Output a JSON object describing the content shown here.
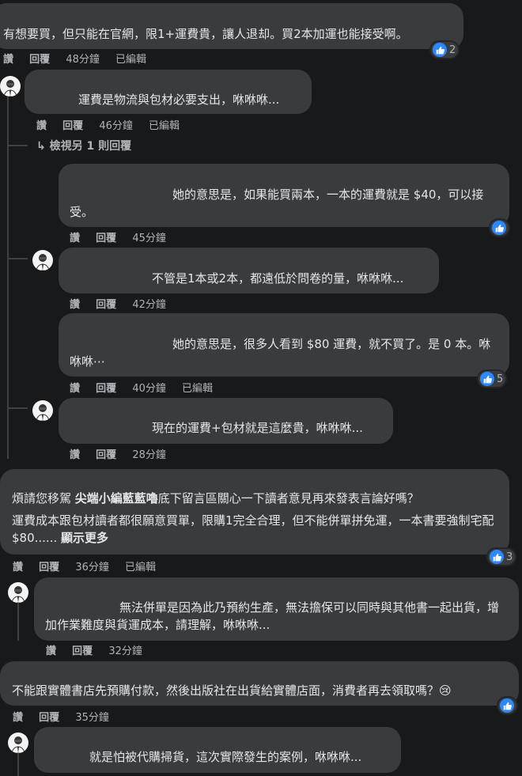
{
  "labels": {
    "like": "讚",
    "reply": "回覆",
    "edited": "已編輯",
    "see_more": "顯示更多"
  },
  "comments": [
    {
      "text": "有想要買，但只能在官網，限1+運費貴，讓人退却。買2本加運也能接受啊。",
      "time": "48分鐘",
      "edited": "已編輯",
      "reactions": "2"
    },
    {
      "text": "運費是物流與包材必要支出，咻咻咻...",
      "time": "46分鐘",
      "edited": "已編輯"
    },
    {
      "view_more": "檢視另 1 則回覆"
    },
    {
      "text": "她的意思是，如果能買兩本，一本的運費就是 $40，可以接受。",
      "time": "45分鐘"
    },
    {
      "text": "不管是1本或2本，都遠低於問卷的量，咻咻咻...",
      "time": "42分鐘"
    },
    {
      "text": "她的意思是，很多人看到 $80 運費，就不買了。是 0 本。咻咻咻⋯",
      "time": "40分鐘",
      "edited": "已編輯",
      "reactions": "5"
    },
    {
      "text": "現在的運費+包材就是這麼貴，咻咻咻...",
      "time": "28分鐘"
    },
    {
      "text_pre": "煩請您移駕 ",
      "mention": "尖端小編藍藍嚕",
      "text_post": "底下留言區關心一下讀者意見再來發表言論好嗎？",
      "text2": "運費成本跟包材讀者都很願意買單，限購1完全合理，但不能併單拼免運，一本書要強制宅配$80......",
      "time": "36分鐘",
      "edited": "已編輯",
      "reactions": "3"
    },
    {
      "text": "無法併單是因為此乃預約生產，無法擔保可以同時與其他書一起出貨，增加作業難度與貨運成本，請理解，咻咻咻...",
      "time": "32分鐘"
    },
    {
      "text": "不能跟實體書店先預購付款，然後出版社在出貨給實體店面，消費者再去領取嗎？",
      "emoji": "😢",
      "time": "35分鐘"
    },
    {
      "text": "就是怕被代購掃貨，這次實際發生的案例，咻咻咻..."
    }
  ]
}
